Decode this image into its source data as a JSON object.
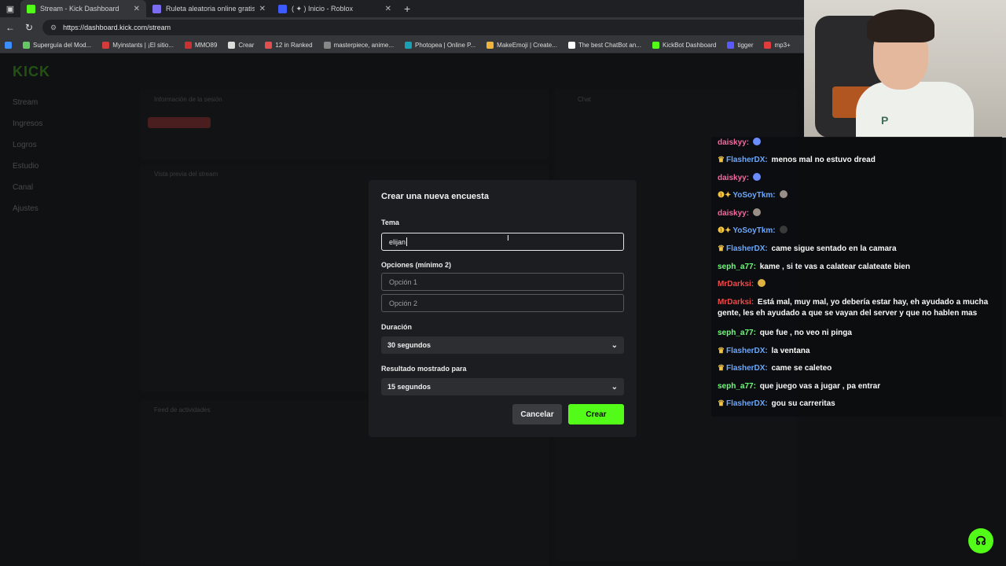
{
  "browser": {
    "tabs": [
      {
        "title": "Stream - Kick Dashboard",
        "color": "#53fc18",
        "active": true
      },
      {
        "title": "Ruleta aleatoria online gratis - Ru",
        "color": "#7a6df0",
        "active": false
      },
      {
        "title": "( ✦ ) Inicio - Roblox",
        "color": "#3d5afe",
        "active": false
      }
    ],
    "url": "https://dashboard.kick.com/stream",
    "bookmarks": [
      "Superguía del Mod...",
      "Myinstants | ¡El sitio...",
      "MMO89",
      "Crear",
      "12 in Ranked",
      "masterpiece, anime...",
      "Photopea | Online P...",
      "MakeEmoji | Create...",
      "The best ChatBot an...",
      "KickBot Dashboard",
      "tigger",
      "mp3+"
    ]
  },
  "dashboard": {
    "logo": "KICK",
    "sidebar": [
      "Stream",
      "Ingresos",
      "Logros",
      "Estudio",
      "Canal",
      "Ajustes"
    ],
    "session_title": "Información de la sesión",
    "chat_title": "Chat",
    "preview_title": "Vista previa del stream",
    "activity_title": "Feed de actividades"
  },
  "modal": {
    "title": "Crear una nueva encuesta",
    "topic_label": "Tema",
    "topic_value": "elijan",
    "options_label": "Opciones (mínimo 2)",
    "option1_placeholder": "Opción 1",
    "option2_placeholder": "Opción 2",
    "duration_label": "Duración",
    "duration_value": "30 segundos",
    "result_label": "Resultado mostrado para",
    "result_value": "15 segundos",
    "cancel_label": "Cancelar",
    "create_label": "Crear"
  },
  "chat": [
    {
      "user": "daiskyy:",
      "text": "",
      "color": "pink",
      "badge": ""
    },
    {
      "user": "FlasherDX:",
      "text": "menos mal no estuvo dread",
      "color": "blue",
      "badge": "👑"
    },
    {
      "user": "daiskyy:",
      "text": "",
      "color": "pink",
      "badge": ""
    },
    {
      "user": "YoSoyTkm:",
      "text": "",
      "color": "blue",
      "badge": "➊✦"
    },
    {
      "user": "daiskyy:",
      "text": "",
      "color": "pink",
      "badge": ""
    },
    {
      "user": "YoSoyTkm:",
      "text": "",
      "color": "blue",
      "badge": "➊✦"
    },
    {
      "user": "FlasherDX:",
      "text": "came sigue sentado en la camara",
      "color": "blue",
      "badge": "👑"
    },
    {
      "user": "seph_a77:",
      "text": "kame , si te vas a calatear calateate bien",
      "color": "green",
      "badge": ""
    },
    {
      "user": "MrDarksi:",
      "text": "",
      "color": "red",
      "badge": ""
    },
    {
      "user": "MrDarksi:",
      "text": "Está mal, muy mal, yo debería estar hay, eh ayudado a mucha gente, les eh ayudado a que se vayan del server y que no hablen mas",
      "color": "red",
      "badge": ""
    },
    {
      "user": "seph_a77:",
      "text": "que fue , no veo ni pinga",
      "color": "green",
      "badge": ""
    },
    {
      "user": "FlasherDX:",
      "text": "la ventana",
      "color": "blue",
      "badge": "👑"
    },
    {
      "user": "FlasherDX:",
      "text": "came se caleteo",
      "color": "blue",
      "badge": "👑"
    },
    {
      "user": "seph_a77:",
      "text": "que juego vas a jugar , pa entrar",
      "color": "green",
      "badge": ""
    },
    {
      "user": "FlasherDX:",
      "text": "gou su carreritas",
      "color": "blue",
      "badge": "👑"
    }
  ],
  "colors": {
    "accent": "#53fc18",
    "modal_bg": "#1c1d20"
  }
}
